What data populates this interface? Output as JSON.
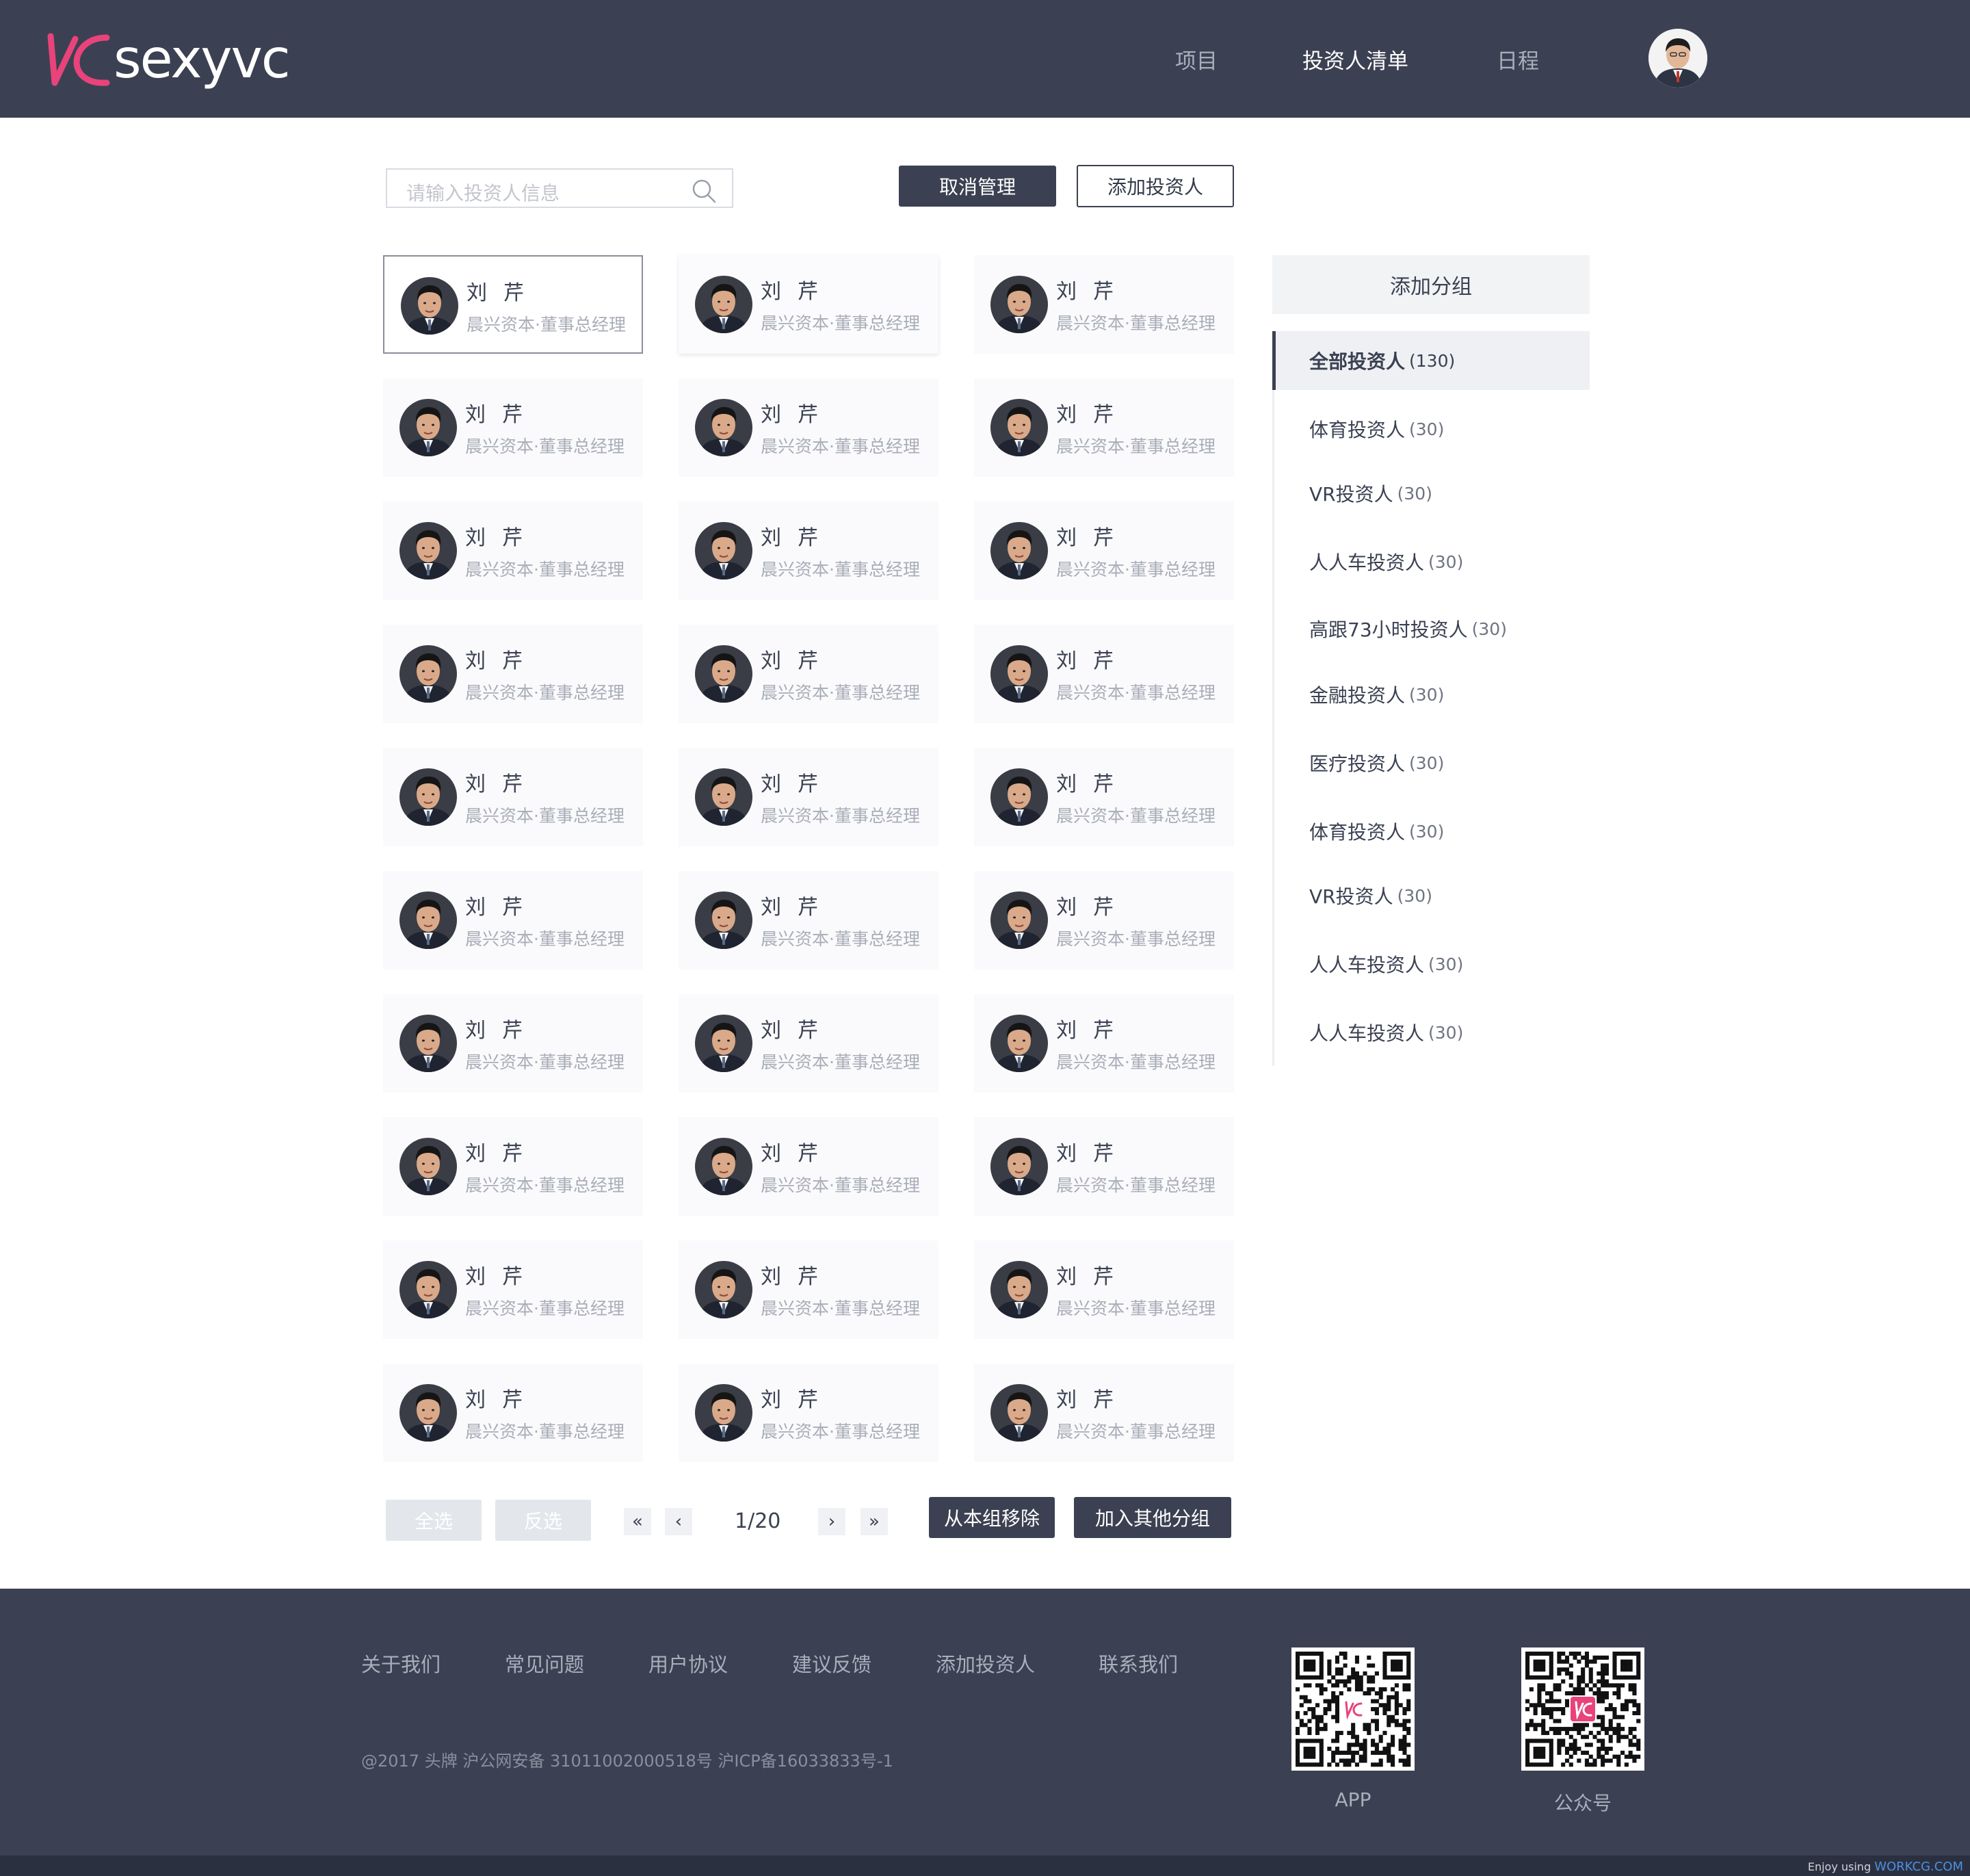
{
  "header": {
    "logo_text": "sexyvc",
    "nav": [
      "项目",
      "投资人清单",
      "日程"
    ],
    "active_nav": "投资人清单"
  },
  "toolbar": {
    "search_placeholder": "请输入投资人信息",
    "cancel_manage": "取消管理",
    "add_investor": "添加投资人"
  },
  "investors": {
    "name": "刘芹",
    "title": "晨兴资本·董事总经理",
    "rows": 10,
    "cols": 3
  },
  "groups": {
    "add_group": "添加分组",
    "items": [
      {
        "label": "全部投资人",
        "count": "(130)",
        "active": true
      },
      {
        "label": "体育投资人",
        "count": "(30)"
      },
      {
        "label": "VR投资人",
        "count": "(30)"
      },
      {
        "label": "人人车投资人",
        "count": "(30)"
      },
      {
        "label": "高跟73小时投资人",
        "count": "(30)"
      },
      {
        "label": "金融投资人",
        "count": "(30)"
      },
      {
        "label": "医疗投资人",
        "count": "(30)"
      },
      {
        "label": "体育投资人",
        "count": "(30)"
      },
      {
        "label": "VR投资人",
        "count": "(30)"
      },
      {
        "label": "人人车投资人",
        "count": "(30)"
      },
      {
        "label": "人人车投资人",
        "count": "(30)"
      }
    ]
  },
  "controls": {
    "select_all": "全选",
    "invert": "反选",
    "first": "«",
    "prev": "‹",
    "page": "1/20",
    "next": "›",
    "last": "»",
    "remove_from_group": "从本组移除",
    "add_to_group": "加入其他分组"
  },
  "footer": {
    "links": [
      "关于我们",
      "常见问题",
      "用户协议",
      "建议反馈",
      "添加投资人",
      "联系我们"
    ],
    "copyright": "@2017 头牌   沪公网安备 31011002000518号 沪ICP备16033833号-1",
    "qr_app_label": "APP",
    "qr_wechat_label": "公众号",
    "watermark_prefix": "Enjoy using",
    "watermark_site": "WORKCG.COM"
  },
  "colors": {
    "header_bg": "#3b4152",
    "brand_pink": "#e8437a",
    "accent_dark": "#3b4152"
  }
}
